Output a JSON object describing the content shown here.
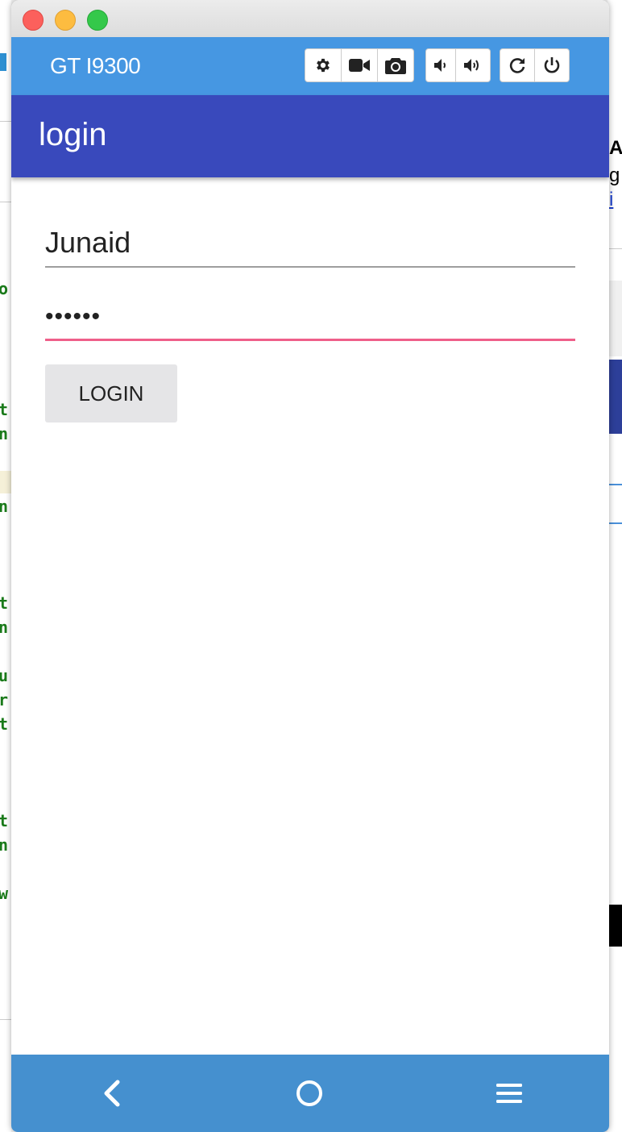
{
  "window": {
    "device_name": "GT I9300",
    "toolbar_icons": [
      "gear-icon",
      "video-camera-icon",
      "camera-icon",
      "volume-down-icon",
      "volume-up-icon",
      "rotate-icon",
      "power-icon"
    ]
  },
  "app": {
    "title": "login",
    "username_value": "Junaid",
    "password_display": "••••••",
    "login_label": "LOGIN"
  },
  "navbar": {
    "icons": [
      "back-icon",
      "home-icon",
      "menu-icon"
    ]
  },
  "colors": {
    "toolbar": "#4697e2",
    "appbar": "#3949bc",
    "focus_underline": "#ef5f8a",
    "navbar": "#4590cf"
  }
}
